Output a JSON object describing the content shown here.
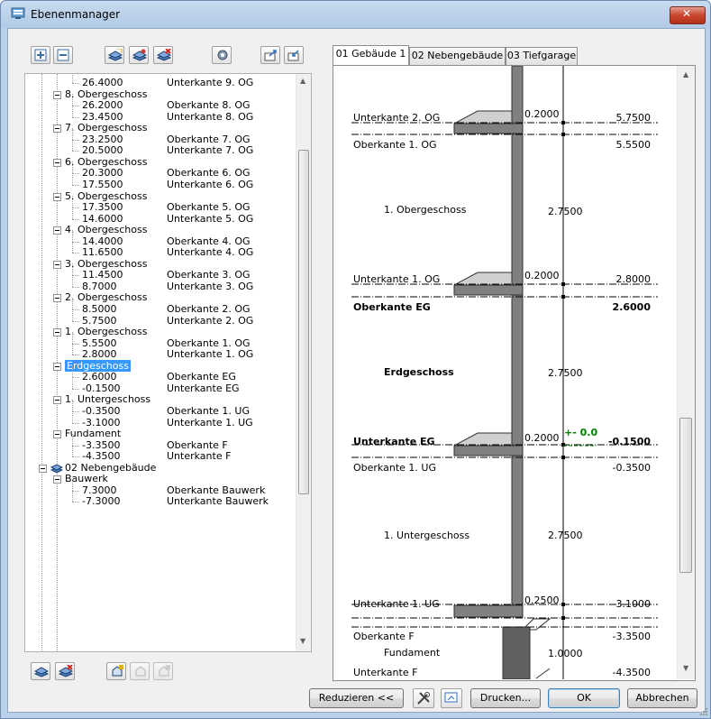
{
  "window": {
    "title": "Ebenenmanager"
  },
  "tree": {
    "rows": [
      {
        "indent": 3,
        "kind": "leaf",
        "value": "26.4000",
        "label": "Unterkante 9. OG"
      },
      {
        "indent": 2,
        "kind": "node",
        "text": "8. Obergeschoss"
      },
      {
        "indent": 3,
        "kind": "leaf",
        "value": "26.2000",
        "label": "Oberkante 8. OG"
      },
      {
        "indent": 3,
        "kind": "leaf",
        "value": "23.4500",
        "label": "Unterkante 8. OG"
      },
      {
        "indent": 2,
        "kind": "node",
        "text": "7. Obergeschoss"
      },
      {
        "indent": 3,
        "kind": "leaf",
        "value": "23.2500",
        "label": "Oberkante 7. OG"
      },
      {
        "indent": 3,
        "kind": "leaf",
        "value": "20.5000",
        "label": "Unterkante 7. OG"
      },
      {
        "indent": 2,
        "kind": "node",
        "text": "6. Obergeschoss"
      },
      {
        "indent": 3,
        "kind": "leaf",
        "value": "20.3000",
        "label": "Oberkante 6. OG"
      },
      {
        "indent": 3,
        "kind": "leaf",
        "value": "17.5500",
        "label": "Unterkante 6. OG"
      },
      {
        "indent": 2,
        "kind": "node",
        "text": "5. Obergeschoss"
      },
      {
        "indent": 3,
        "kind": "leaf",
        "value": "17.3500",
        "label": "Oberkante 5. OG"
      },
      {
        "indent": 3,
        "kind": "leaf",
        "value": "14.6000",
        "label": "Unterkante 5. OG"
      },
      {
        "indent": 2,
        "kind": "node",
        "text": "4. Obergeschoss"
      },
      {
        "indent": 3,
        "kind": "leaf",
        "value": "14.4000",
        "label": "Oberkante 4. OG"
      },
      {
        "indent": 3,
        "kind": "leaf",
        "value": "11.6500",
        "label": "Unterkante 4. OG"
      },
      {
        "indent": 2,
        "kind": "node",
        "text": "3. Obergeschoss"
      },
      {
        "indent": 3,
        "kind": "leaf",
        "value": "11.4500",
        "label": "Oberkante 3. OG"
      },
      {
        "indent": 3,
        "kind": "leaf",
        "value": "8.7000",
        "label": "Unterkante 3. OG"
      },
      {
        "indent": 2,
        "kind": "node",
        "text": "2. Obergeschoss"
      },
      {
        "indent": 3,
        "kind": "leaf",
        "value": "8.5000",
        "label": "Oberkante 2. OG"
      },
      {
        "indent": 3,
        "kind": "leaf",
        "value": "5.7500",
        "label": "Unterkante 2. OG"
      },
      {
        "indent": 2,
        "kind": "node",
        "text": "1. Obergeschoss"
      },
      {
        "indent": 3,
        "kind": "leaf",
        "value": "5.5500",
        "label": "Oberkante 1. OG"
      },
      {
        "indent": 3,
        "kind": "leaf",
        "value": "2.8000",
        "label": "Unterkante 1. OG"
      },
      {
        "indent": 2,
        "kind": "node",
        "text": "Erdgeschoss",
        "selected": true
      },
      {
        "indent": 3,
        "kind": "leaf",
        "value": "2.6000",
        "label": "Oberkante EG"
      },
      {
        "indent": 3,
        "kind": "leaf",
        "value": "-0.1500",
        "label": "Unterkante EG"
      },
      {
        "indent": 2,
        "kind": "node",
        "text": "1. Untergeschoss"
      },
      {
        "indent": 3,
        "kind": "leaf",
        "value": "-0.3500",
        "label": "Oberkante 1. UG"
      },
      {
        "indent": 3,
        "kind": "leaf",
        "value": "-3.1000",
        "label": "Unterkante 1. UG"
      },
      {
        "indent": 2,
        "kind": "node",
        "text": "Fundament"
      },
      {
        "indent": 3,
        "kind": "leaf",
        "value": "-3.3500",
        "label": "Oberkante F"
      },
      {
        "indent": 3,
        "kind": "leaf",
        "value": "-4.3500",
        "label": "Unterkante F"
      },
      {
        "indent": 1,
        "kind": "building",
        "text": "02 Nebengebäude"
      },
      {
        "indent": 2,
        "kind": "node",
        "text": "Bauwerk"
      },
      {
        "indent": 3,
        "kind": "leaf",
        "value": "7.3000",
        "label": "Oberkante Bauwerk"
      },
      {
        "indent": 3,
        "kind": "leaf",
        "value": "-7.3000",
        "label": "Unterkante Bauwerk"
      }
    ]
  },
  "tabs": [
    {
      "label": "01 Gebäude 1",
      "active": true
    },
    {
      "label": "02 Nebengebäude",
      "active": false
    },
    {
      "label": "03 Tiefgarage",
      "active": false
    }
  ],
  "diagram": {
    "uk_2og": "Unterkante 2. OG",
    "uk_2og_thick": "0.2000",
    "uk_2og_val": "5.7500",
    "ok_1og": "Oberkante 1. OG",
    "ok_1og_val": "5.5500",
    "og1_name": "1. Obergeschoss",
    "og1_height": "2.7500",
    "uk_1og": "Unterkante 1. OG",
    "uk_1og_thick": "0.2000",
    "uk_1og_val": "2.8000",
    "ok_eg": "Oberkante EG",
    "ok_eg_val": "2.6000",
    "eg_name": "Erdgeschoss",
    "eg_height": "2.7500",
    "uk_eg": "Unterkante EG",
    "uk_eg_thick": "0.2000",
    "uk_eg_marker": "+- 0.0",
    "uk_eg_val": "-0.1500",
    "ok_1ug": "Oberkante 1. UG",
    "ok_1ug_val": "-0.3500",
    "ug1_name": "1. Untergeschoss",
    "ug1_height": "2.7500",
    "uk_1ug": "Unterkante 1. UG",
    "uk_1ug_thick": "0.2500",
    "uk_1ug_val": "-3.1000",
    "ok_f": "Oberkante F",
    "ok_f_val": "-3.3500",
    "f_name": "Fundament",
    "f_height": "1.0000",
    "uk_f": "Unterkante F",
    "uk_f_val": "-4.3500",
    "accent": "#008000"
  },
  "buttons": {
    "reduce": "Reduzieren <<",
    "print": "Drucken...",
    "ok": "OK",
    "cancel": "Abbrechen"
  }
}
